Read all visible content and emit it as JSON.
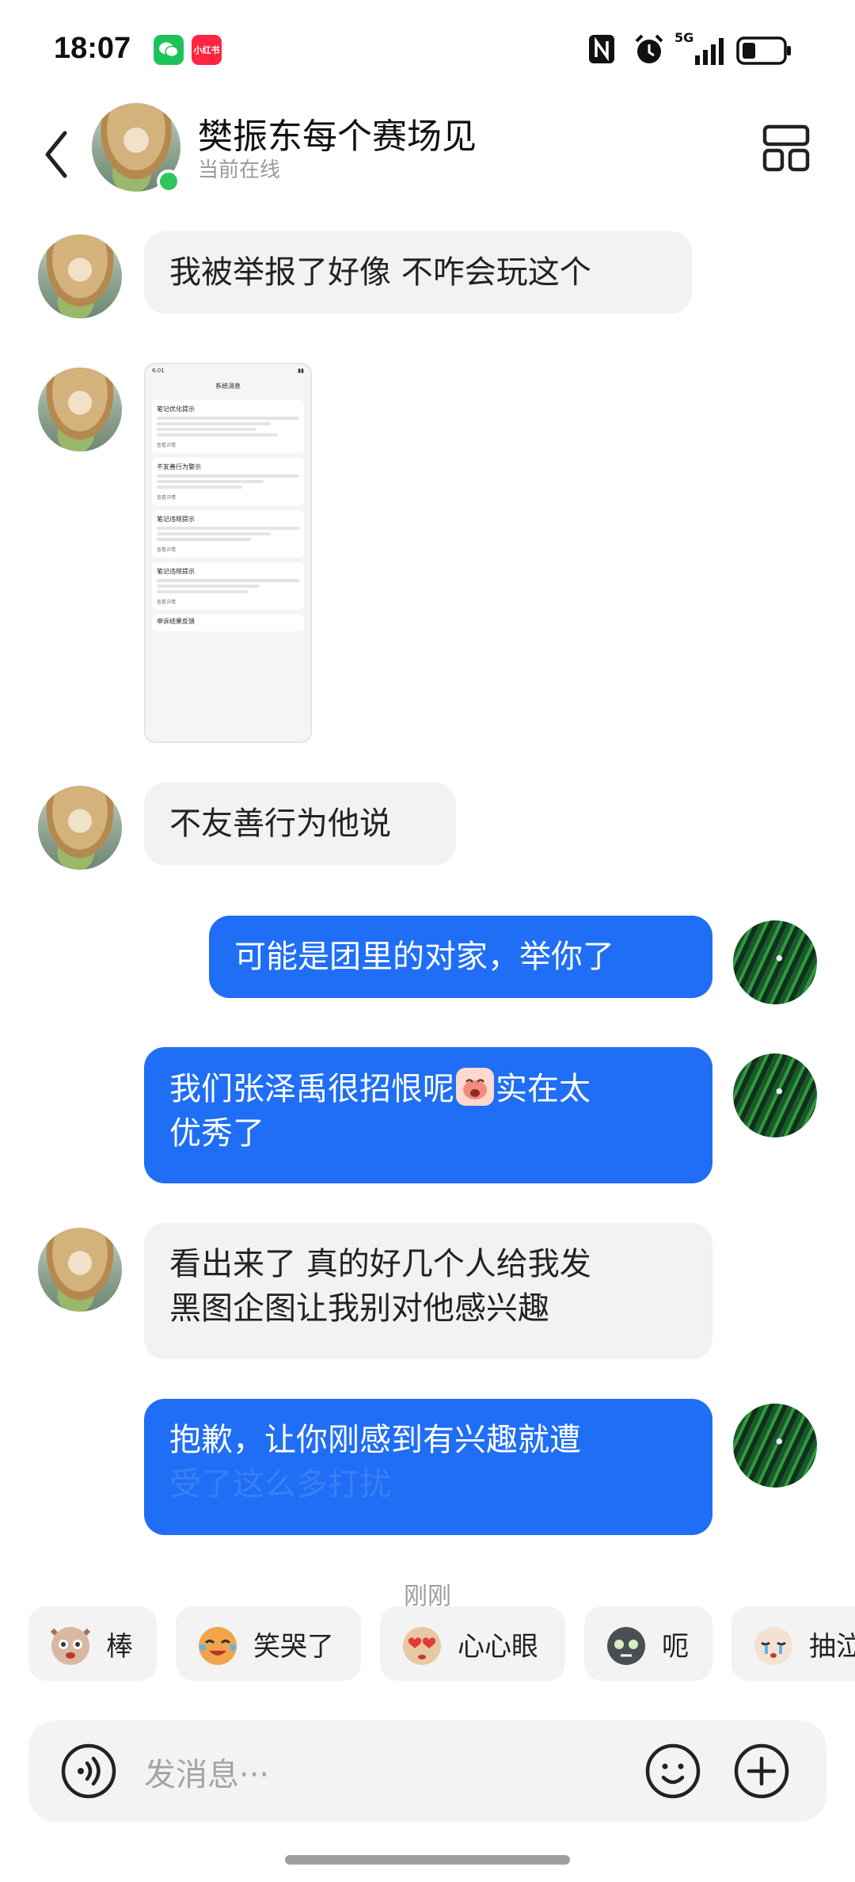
{
  "status_bar": {
    "time": "18:07",
    "wechat_badge": "",
    "xhs_badge": "小红书",
    "network": "5G"
  },
  "header": {
    "name": "樊振东每个赛场见",
    "status": "当前在线"
  },
  "messages": [
    {
      "from": "them",
      "text": "我被举报了好像 不咋会玩这个"
    },
    {
      "from": "them",
      "type": "image"
    },
    {
      "from": "them",
      "text": "不友善行为他说"
    },
    {
      "from": "me",
      "text": "可能是团里的对家，举你了"
    },
    {
      "from": "me",
      "text_1": "我们张泽禹很招恨呢",
      "text_2": "实在太",
      "text_3": "优秀了"
    },
    {
      "from": "them",
      "text_1": "看出来了 真的好几个人给我发",
      "text_2": "黑图企图让我别对他感兴趣"
    },
    {
      "from": "me",
      "text_1": "抱歉，让你刚感到有兴趣就遭",
      "text_2": "受了这么多打扰"
    }
  ],
  "screenshot_thumb": {
    "time": "6:01",
    "title": "系统消息",
    "cards": [
      "笔记优化提示",
      "不友善行为警示",
      "笔记违规提示",
      "笔记违规提示"
    ],
    "more": "查看详情",
    "footer": "申诉结果反馈"
  },
  "time_label": "刚刚",
  "reactions": [
    {
      "label": "棒",
      "icon": "cat-sticker-icon"
    },
    {
      "label": "笑哭了",
      "icon": "cat-laugh-cry-icon"
    },
    {
      "label": "心心眼",
      "icon": "cat-heart-eyes-icon"
    },
    {
      "label": "呃",
      "icon": "cat-awkward-icon"
    },
    {
      "label": "抽泣",
      "icon": "cat-sob-icon"
    }
  ],
  "input": {
    "placeholder": "发消息···"
  },
  "colors": {
    "accent": "#1f6ef5",
    "online": "#2fc65b",
    "incoming_bubble": "#f2f2f2"
  }
}
